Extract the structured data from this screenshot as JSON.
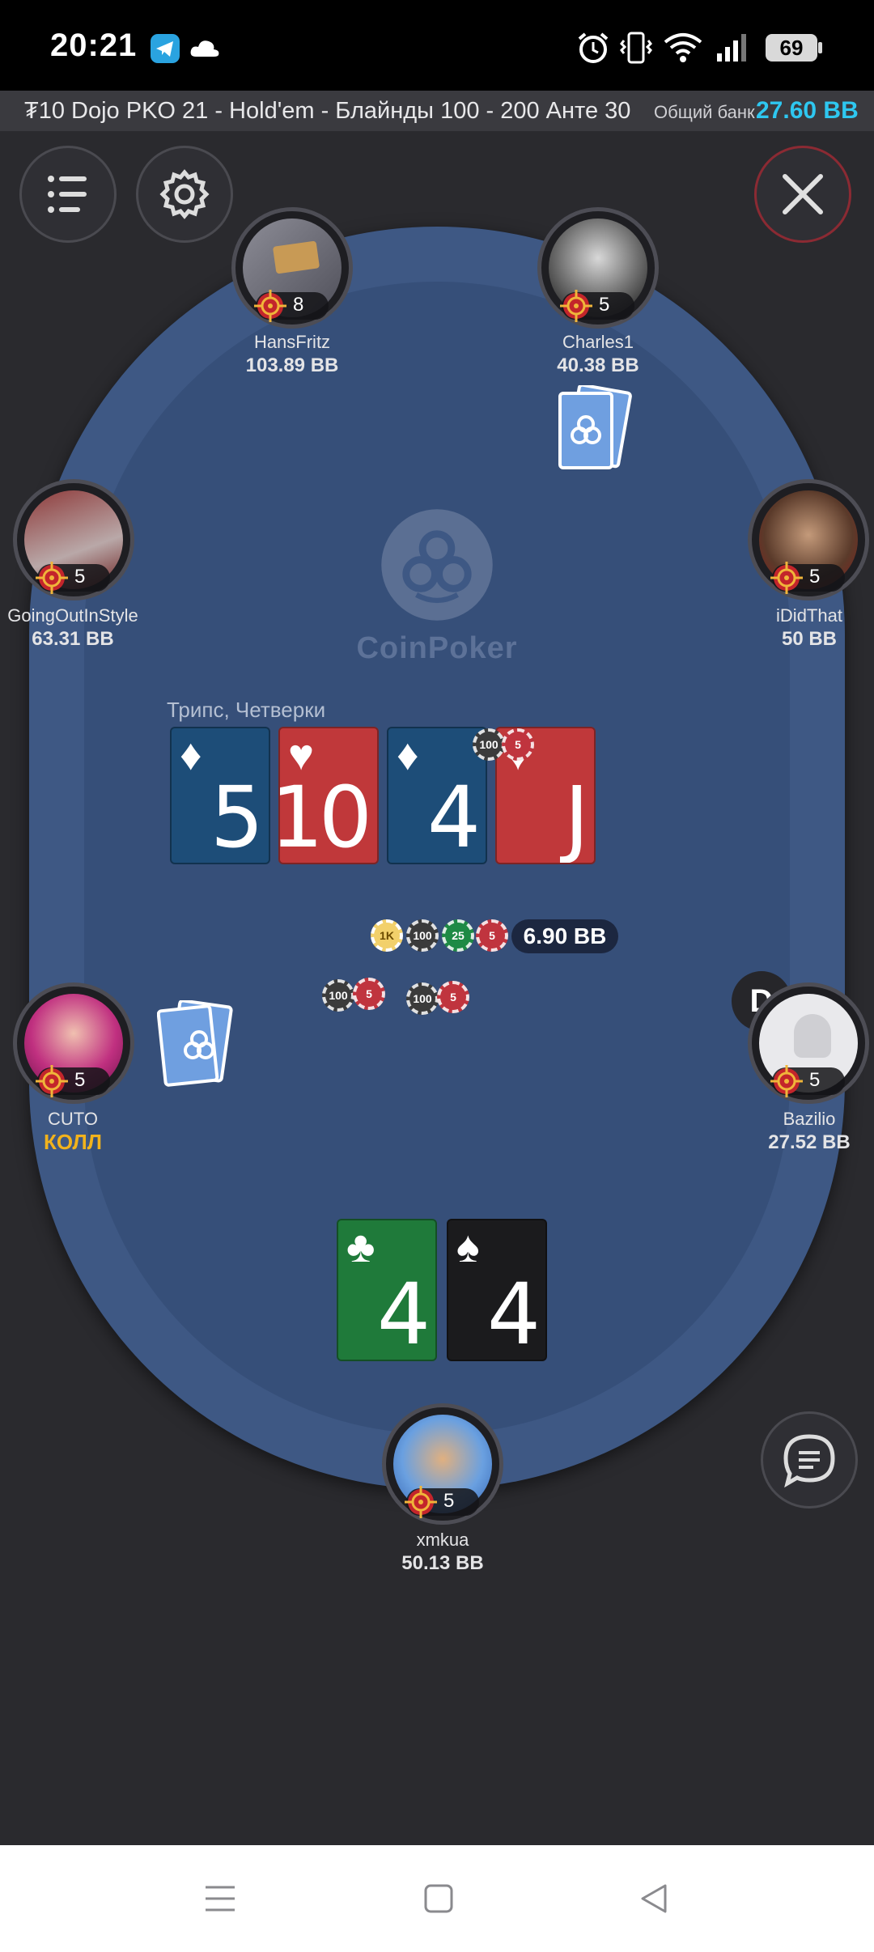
{
  "status_bar": {
    "time": "20:21",
    "battery": "69",
    "icons": [
      "telegram-icon",
      "cloud-icon",
      "alarm-icon",
      "vibrate-icon",
      "wifi-icon",
      "signal-icon"
    ]
  },
  "title_bar": {
    "table_name": "₮10 Dojo PKO 21 - Hold'em - Блайнды 100 - 200 Анте 30",
    "bank_label": "Общий банк",
    "bank_value": "27.60 BB"
  },
  "logo_text": "CoinPoker",
  "board": {
    "hand_label": "Трипс, Четверки",
    "cards": [
      {
        "rank": "5",
        "suit": "♦",
        "color": "diamond"
      },
      {
        "rank": "10",
        "suit": "♥",
        "color": "heart"
      },
      {
        "rank": "4",
        "suit": "♦",
        "color": "diamond"
      },
      {
        "rank": "J",
        "suit": "♥",
        "color": "heart"
      }
    ]
  },
  "pot": {
    "chips": [
      "1K",
      "100",
      "25",
      "5"
    ],
    "amount": "6.90 BB"
  },
  "bet_chips": {
    "board_stack": [
      "100",
      "5"
    ],
    "left_stack": [
      "100",
      "5"
    ],
    "right_stack": [
      "100",
      "5"
    ]
  },
  "dealer_button": "D",
  "players": {
    "hansfritz": {
      "name": "HansFritz",
      "stack": "103.89 BB",
      "bounty": "8"
    },
    "charles1": {
      "name": "Charles1",
      "stack": "40.38 BB",
      "bounty": "5"
    },
    "goingoutinstyle": {
      "name": "GoingOutInStyle",
      "stack": "63.31 BB",
      "bounty": "5"
    },
    "ididthat": {
      "name": "iDidThat",
      "stack": "50 BB",
      "bounty": "5"
    },
    "cuto": {
      "name": "CUTO",
      "action": "КОЛЛ",
      "bounty": "5"
    },
    "bazilio": {
      "name": "Bazilio",
      "stack": "27.52 BB",
      "bounty": "5"
    },
    "xmkua": {
      "name": "xmkua",
      "stack": "50.13 BB",
      "bounty": "5"
    }
  },
  "hero_cards": [
    {
      "rank": "4",
      "suit": "♣",
      "color": "club"
    },
    {
      "rank": "4",
      "suit": "♠",
      "color": "spade"
    }
  ],
  "colors": {
    "accent": "#2ec7f0",
    "table": "#3e5884",
    "action": "#f2b31c"
  }
}
